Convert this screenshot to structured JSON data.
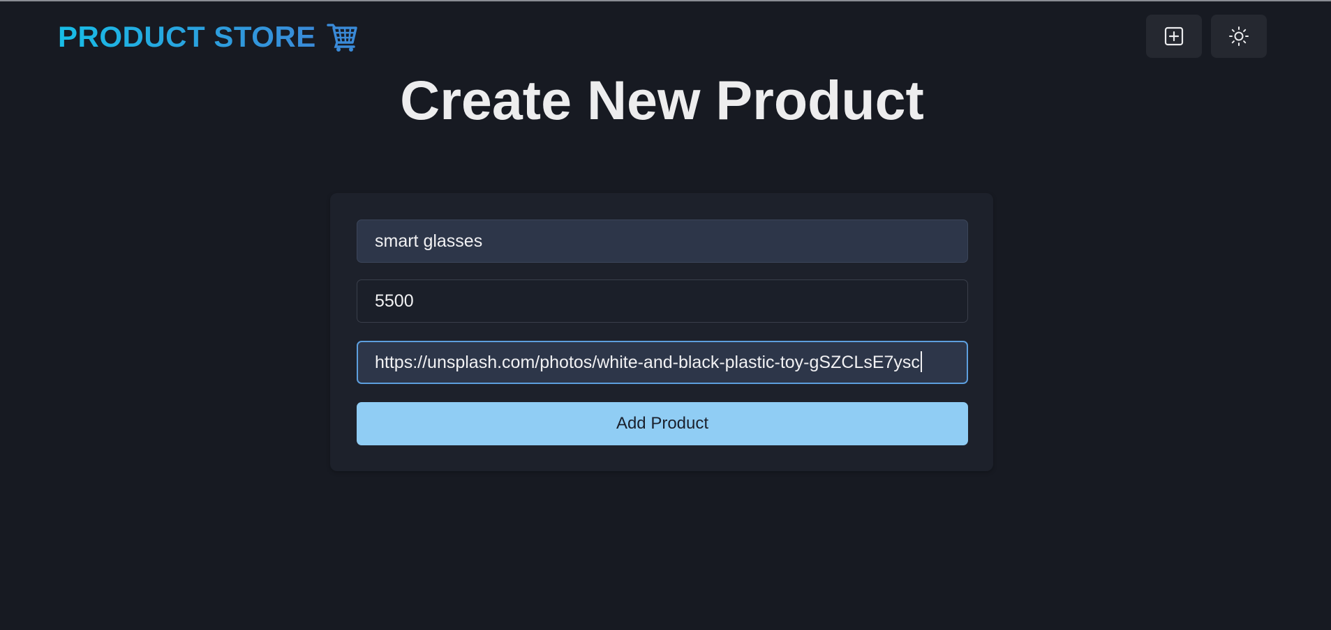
{
  "brand": {
    "title": "PRODUCT STORE",
    "icon": "shopping-cart-icon",
    "gradient_from": "#18bde6",
    "gradient_to": "#3a8ad8"
  },
  "nav": {
    "buttons": [
      {
        "icon": "plus-square-icon"
      },
      {
        "icon": "sun-icon"
      }
    ]
  },
  "page": {
    "title": "Create New Product"
  },
  "form": {
    "name_value": "smart glasses",
    "price_value": "5500",
    "image_value": "https://unsplash.com/photos/white-and-black-plastic-toy-gSZCLsE7ysc",
    "submit_label": "Add Product",
    "accent_color": "#90cdf4"
  }
}
